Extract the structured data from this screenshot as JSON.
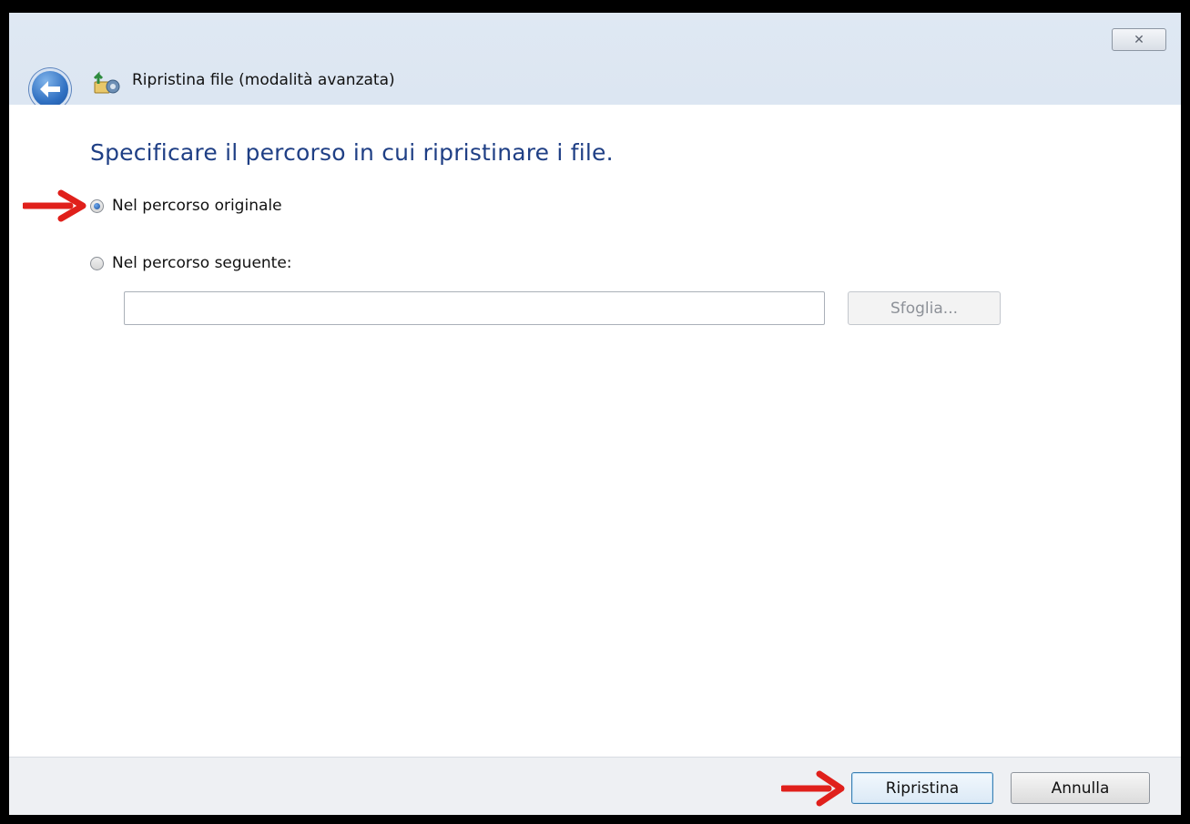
{
  "window": {
    "title": "Ripristina file (modalità avanzata)",
    "close_symbol": "✕",
    "back_icon": "back-arrow-icon",
    "app_icon": "restore-files-icon"
  },
  "main": {
    "heading": "Specificare il percorso in cui ripristinare i file.",
    "options": [
      {
        "label": "Nel percorso originale",
        "selected": true
      },
      {
        "label": "Nel percorso seguente:",
        "selected": false
      }
    ],
    "path_input": {
      "value": "",
      "placeholder": ""
    },
    "browse_label": "Sfoglia..."
  },
  "footer": {
    "restore_label": "Ripristina",
    "cancel_label": "Annulla"
  },
  "annotations": {
    "arrow_color": "#e0201b",
    "arrow_icon": "red-arrow-icon"
  },
  "colors": {
    "heading": "#1f3f85",
    "header_bg": "#dce6f2"
  }
}
